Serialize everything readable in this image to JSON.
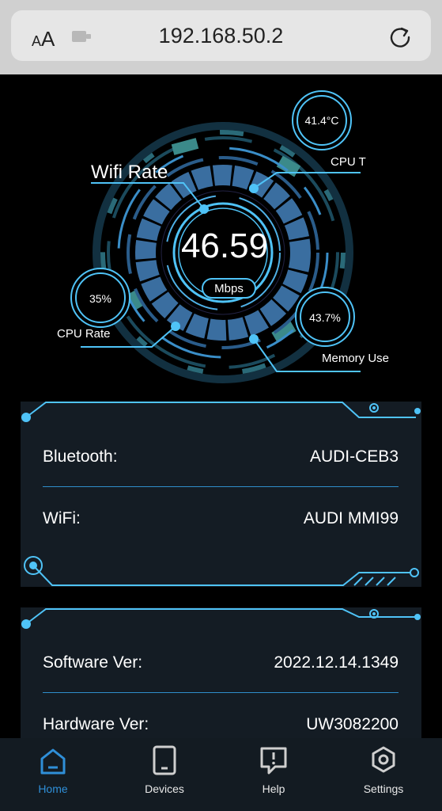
{
  "browser": {
    "text_size_label": "AA",
    "url": "192.168.50.2"
  },
  "dashboard": {
    "wifi_rate_label": "Wifi Rate",
    "wifi_rate_value": "46.59",
    "wifi_rate_unit": "Mbps",
    "cpu_temp_value": "41.4°C",
    "cpu_temp_label": "CPU T",
    "cpu_rate_value": "35%",
    "cpu_rate_label": "CPU Rate",
    "memory_value": "43.7%",
    "memory_label": "Memory Use"
  },
  "connection_card": {
    "rows": [
      {
        "label": "Bluetooth:",
        "value": "AUDI-CEB3"
      },
      {
        "label": "WiFi:",
        "value": "AUDI MMI99"
      }
    ]
  },
  "version_card": {
    "rows": [
      {
        "label": "Software Ver:",
        "value": "2022.12.14.1349"
      },
      {
        "label": "Hardware Ver:",
        "value": "UW3082200"
      }
    ]
  },
  "tabs": [
    {
      "label": "Home",
      "icon": "home-icon",
      "active": true
    },
    {
      "label": "Devices",
      "icon": "device-icon",
      "active": false
    },
    {
      "label": "Help",
      "icon": "help-icon",
      "active": false
    },
    {
      "label": "Settings",
      "icon": "settings-icon",
      "active": false
    }
  ],
  "colors": {
    "accent": "#2f8fd8",
    "cyan": "#4fc3f7",
    "card": "#141c24",
    "tabbar": "#131b22"
  }
}
